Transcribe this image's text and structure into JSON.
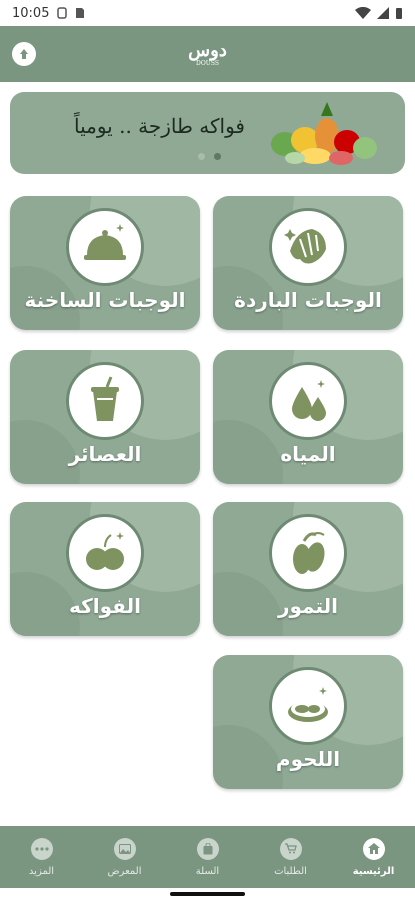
{
  "status_bar": {
    "time": "10:05"
  },
  "header": {
    "logo_main": "دوس",
    "logo_sub": "DOUSS"
  },
  "banner": {
    "text": "فواكه طازجة .. يومياً",
    "active_dot": 1
  },
  "categories": [
    {
      "label": "الوجبات الباردة",
      "icon": "croissant-icon"
    },
    {
      "label": "الوجبات الساخنة",
      "icon": "cloche-icon"
    },
    {
      "label": "المياه",
      "icon": "water-drops-icon"
    },
    {
      "label": "العصائر",
      "icon": "juice-cup-icon"
    },
    {
      "label": "التمور",
      "icon": "dates-icon"
    },
    {
      "label": "الفواكه",
      "icon": "fruit-icon"
    },
    {
      "label": "اللحوم",
      "icon": "meat-icon"
    }
  ],
  "bottom_nav": [
    {
      "label": "الرئيسية",
      "icon": "home-icon",
      "active": true
    },
    {
      "label": "الطلبات",
      "icon": "cart-icon",
      "active": false
    },
    {
      "label": "السلة",
      "icon": "bag-icon",
      "active": false
    },
    {
      "label": "المعرض",
      "icon": "gallery-icon",
      "active": false
    },
    {
      "label": "المزيد",
      "icon": "more-icon",
      "active": false
    }
  ],
  "colors": {
    "primary": "#7a9580",
    "card": "#8fa995",
    "icon_fill": "#7f9360"
  }
}
